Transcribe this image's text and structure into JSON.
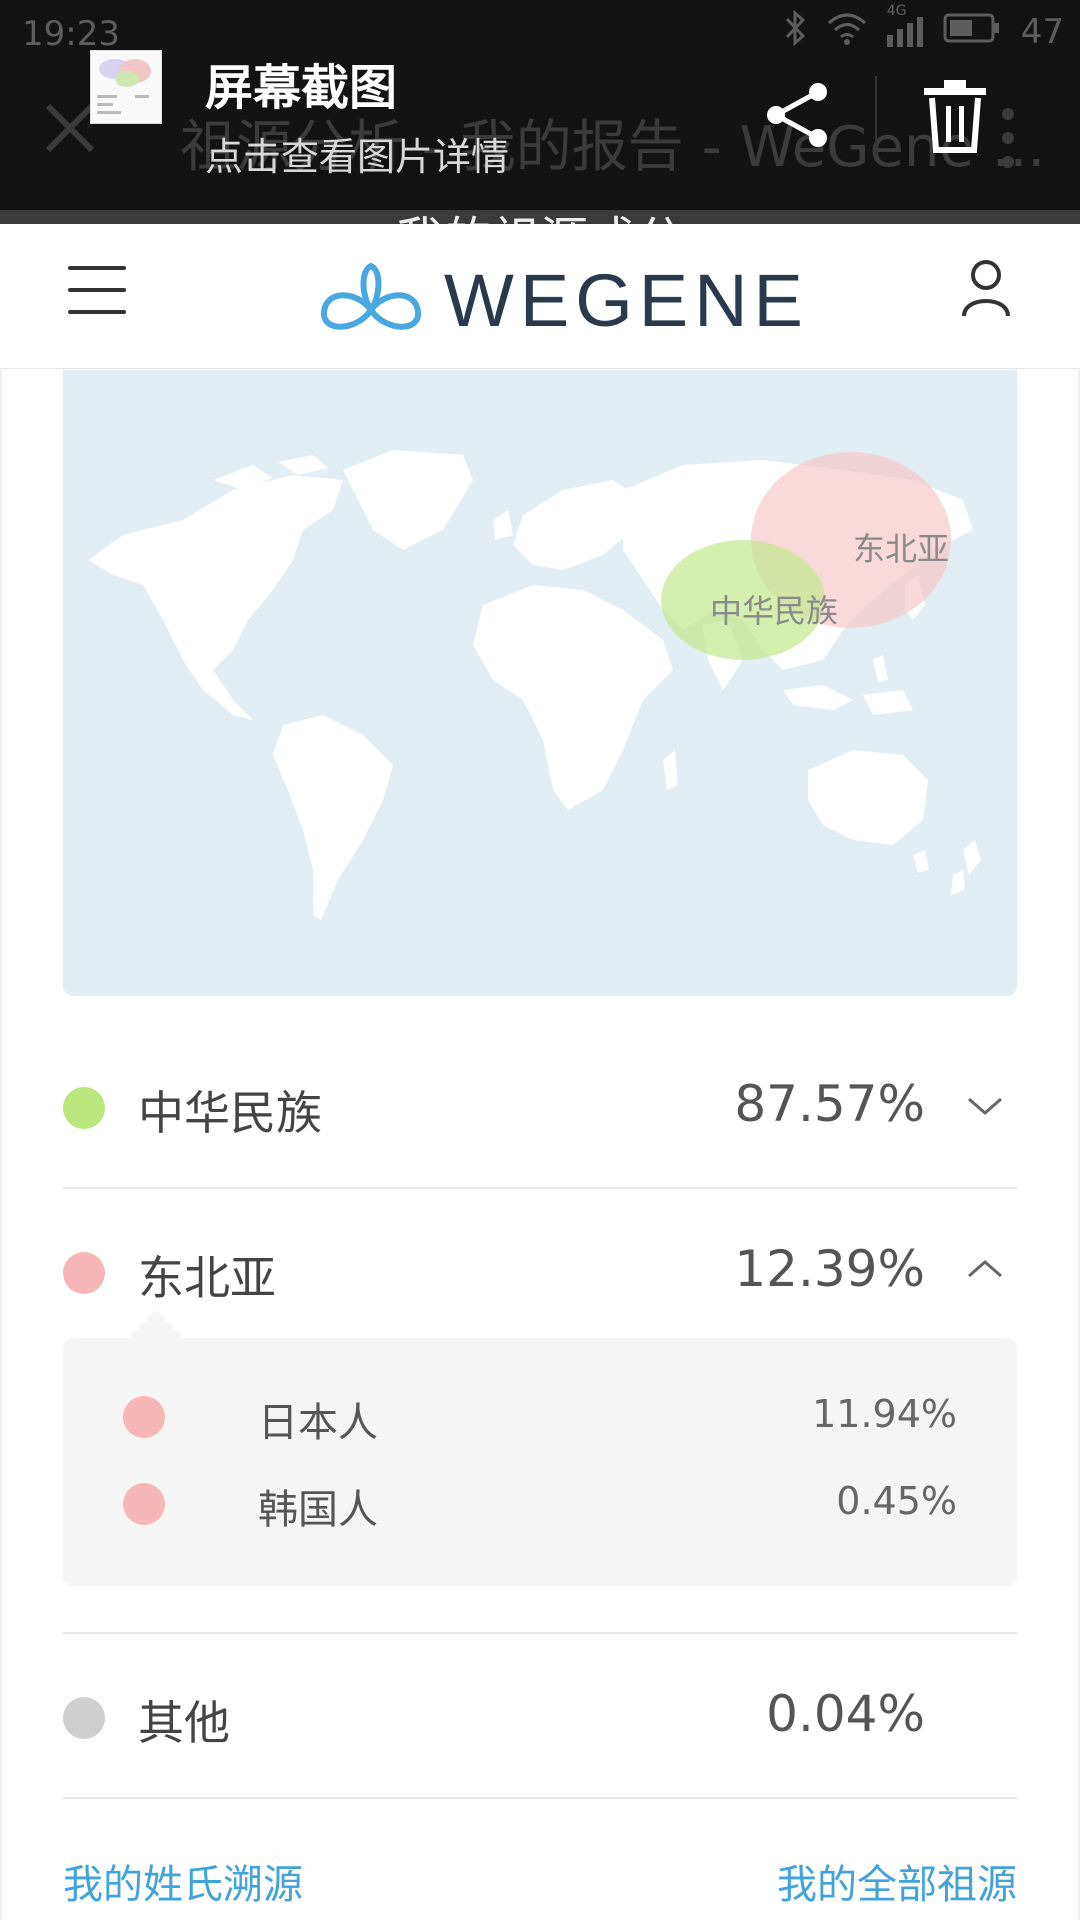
{
  "status_bar": {
    "time": "19:23",
    "network": "4G",
    "battery": "47"
  },
  "screenshot_notification": {
    "title": "屏幕截图",
    "subtitle": "点击查看图片详情",
    "background_page_title": "祖源分析 - 我的报告 - WeGene ..."
  },
  "background_heading": "我的祖源成分",
  "header": {
    "logo_text": "WEGENE"
  },
  "map": {
    "regions": [
      {
        "label": "中华民族",
        "color": "#c3e88e"
      },
      {
        "label": "东北亚",
        "color": "#f6c4c4"
      }
    ]
  },
  "ancestry": [
    {
      "label": "中华民族",
      "percent": "87.57%",
      "color": "#b9e67f",
      "expanded": false
    },
    {
      "label": "东北亚",
      "percent": "12.39%",
      "color": "#f8b7b7",
      "expanded": true,
      "children": [
        {
          "label": "日本人",
          "percent": "11.94%",
          "color": "#f8b7b7"
        },
        {
          "label": "韩国人",
          "percent": "0.45%",
          "color": "#f8b7b7"
        }
      ]
    },
    {
      "label": "其他",
      "percent": "0.04%",
      "color": "#cfcfcf",
      "expanded": false
    }
  ],
  "footer": {
    "surname_link": "我的姓氏溯源",
    "all_ancestry_link": "我的全部祖源"
  },
  "colors": {
    "accent": "#41a3dc",
    "logo_blue": "#4aa8e0"
  }
}
